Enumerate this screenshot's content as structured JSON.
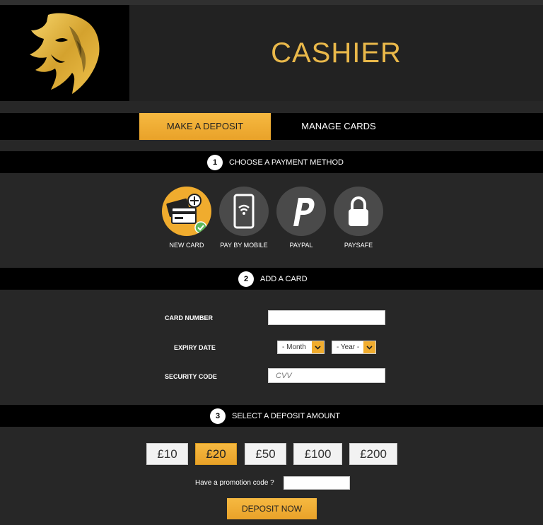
{
  "header": {
    "title": "CASHIER"
  },
  "tabs": {
    "deposit": "MAKE A DEPOSIT",
    "manage": "MANAGE CARDS"
  },
  "steps": [
    {
      "number": "1",
      "label": "CHOOSE A PAYMENT METHOD"
    },
    {
      "number": "2",
      "label": "ADD A CARD"
    },
    {
      "number": "3",
      "label": "SELECT A DEPOSIT AMOUNT"
    }
  ],
  "payment_methods": [
    {
      "label": "NEW CARD",
      "icon": "credit-card-add-icon",
      "selected": true
    },
    {
      "label": "PAY BY MOBILE",
      "icon": "mobile-phone-icon"
    },
    {
      "label": "PAYPAL",
      "icon": "paypal-icon"
    },
    {
      "label": "PAYSAFE",
      "icon": "paysafe-lock-icon"
    }
  ],
  "card_form": {
    "card_number_label": "CARD NUMBER",
    "card_number_value": "",
    "expiry_label": "EXPIRY DATE",
    "month": "- Month",
    "year": "- Year -",
    "security_label": "SECURITY CODE",
    "cvv_placeholder": "CVV"
  },
  "amounts": [
    {
      "label": "£10"
    },
    {
      "label": "£20",
      "selected": true
    },
    {
      "label": "£50"
    },
    {
      "label": "£100"
    },
    {
      "label": "£200"
    }
  ],
  "promo": {
    "label": "Have a promotion code ?",
    "value": ""
  },
  "deposit_button": "DEPOSIT NOW",
  "colors": {
    "accent": "#f0ac2e",
    "title": "#e9b84a",
    "bar": "#000000",
    "background": "#272727"
  }
}
